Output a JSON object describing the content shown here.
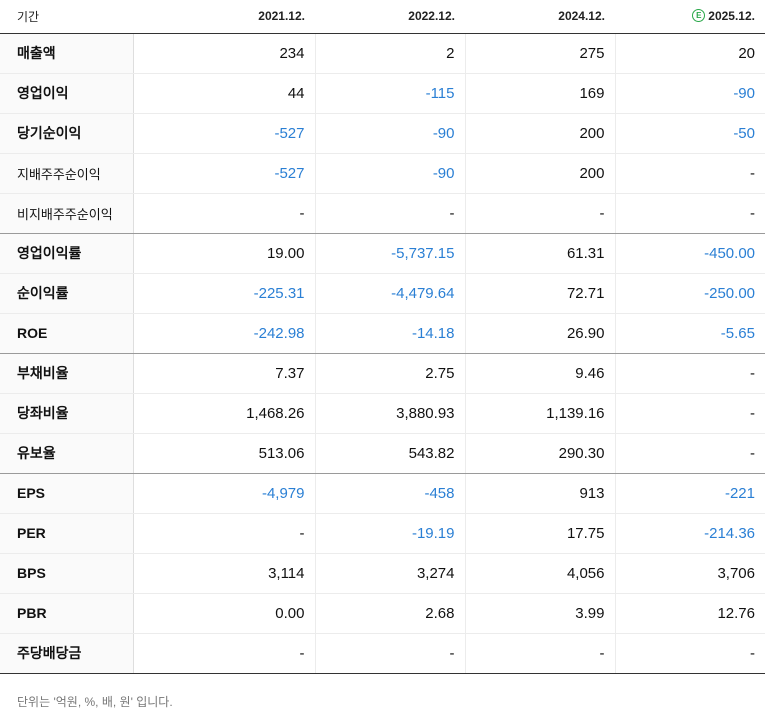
{
  "header": {
    "label": "기간",
    "periods": [
      "2021.12.",
      "2022.12.",
      "2024.12.",
      "2025.12."
    ],
    "estimate_icon": "estimate-e-icon",
    "estimate_glyph": "E"
  },
  "rows": [
    {
      "label": "매출액",
      "values": [
        "234",
        "2",
        "275",
        "20"
      ]
    },
    {
      "label": "영업이익",
      "values": [
        "44",
        "-115",
        "169",
        "-90"
      ]
    },
    {
      "label": "당기순이익",
      "values": [
        "-527",
        "-90",
        "200",
        "-50"
      ]
    },
    {
      "label": "지배주주순이익",
      "values": [
        "-527",
        "-90",
        "200",
        "-"
      ]
    },
    {
      "label": "비지배주주순이익",
      "values": [
        "-",
        "-",
        "-",
        "-"
      ]
    },
    {
      "label": "영업이익률",
      "values": [
        "19.00",
        "-5,737.15",
        "61.31",
        "-450.00"
      ]
    },
    {
      "label": "순이익률",
      "values": [
        "-225.31",
        "-4,479.64",
        "72.71",
        "-250.00"
      ]
    },
    {
      "label": "ROE",
      "values": [
        "-242.98",
        "-14.18",
        "26.90",
        "-5.65"
      ]
    },
    {
      "label": "부채비율",
      "values": [
        "7.37",
        "2.75",
        "9.46",
        "-"
      ]
    },
    {
      "label": "당좌비율",
      "values": [
        "1,468.26",
        "3,880.93",
        "1,139.16",
        "-"
      ]
    },
    {
      "label": "유보율",
      "values": [
        "513.06",
        "543.82",
        "290.30",
        "-"
      ]
    },
    {
      "label": "EPS",
      "values": [
        "-4,979",
        "-458",
        "913",
        "-221"
      ]
    },
    {
      "label": "PER",
      "values": [
        "-",
        "-19.19",
        "17.75",
        "-214.36"
      ]
    },
    {
      "label": "BPS",
      "values": [
        "3,114",
        "3,274",
        "4,056",
        "3,706"
      ]
    },
    {
      "label": "PBR",
      "values": [
        "0.00",
        "2.68",
        "3.99",
        "12.76"
      ]
    },
    {
      "label": "주당배당금",
      "values": [
        "-",
        "-",
        "-",
        "-"
      ]
    }
  ],
  "footnote": "단위는 '억원, %, 배, 원' 입니다.",
  "colors": {
    "negative": "#2a7fd4",
    "estimate": "#2aa84a"
  }
}
